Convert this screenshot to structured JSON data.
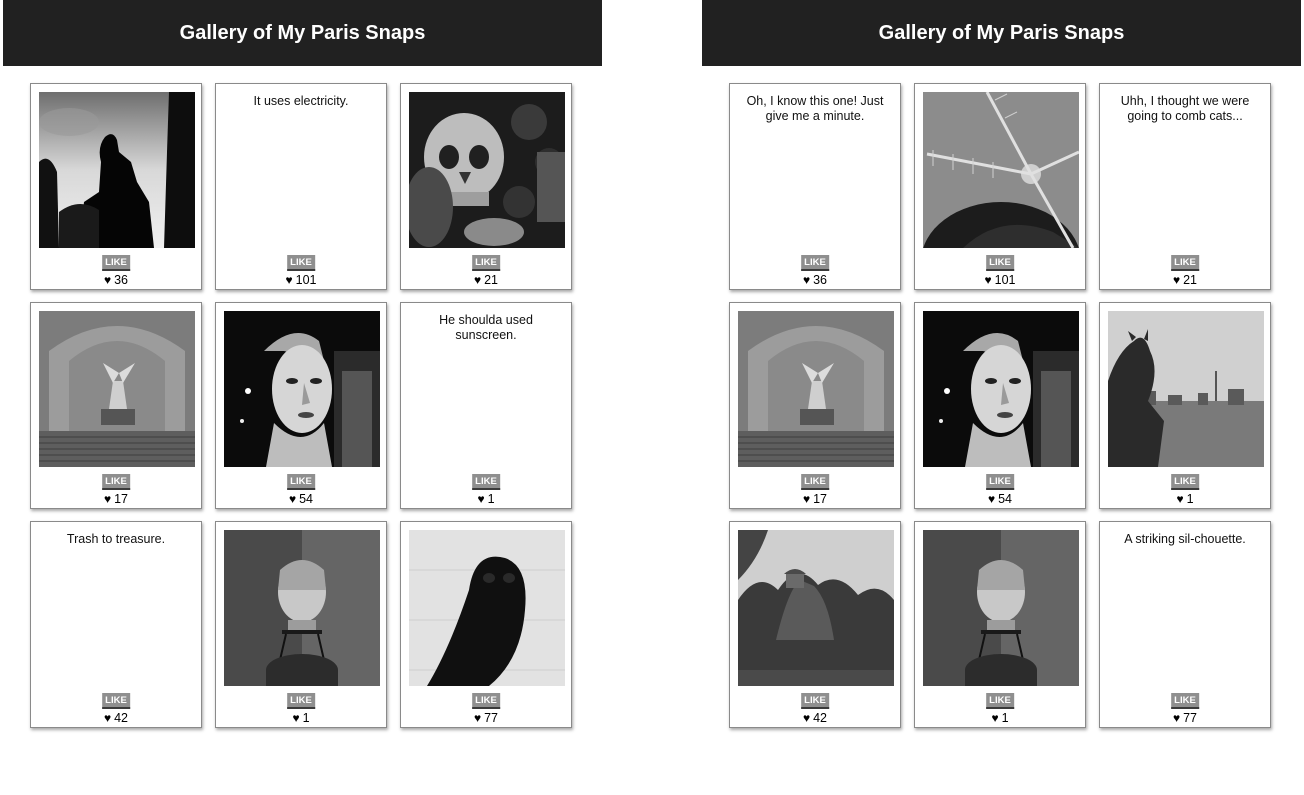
{
  "panels": [
    {
      "title": "Gallery of My Paris Snaps",
      "like_label": "LIKE",
      "cards": [
        {
          "kind": "photo",
          "photo": "thinker-silhouette",
          "likes": "36"
        },
        {
          "kind": "text",
          "caption": "It uses electricity.",
          "likes": "101"
        },
        {
          "kind": "photo",
          "photo": "skull-catacombs",
          "likes": "21"
        },
        {
          "kind": "photo",
          "photo": "winged-victory",
          "likes": "17"
        },
        {
          "kind": "photo",
          "photo": "mannequin-head",
          "likes": "54"
        },
        {
          "kind": "text",
          "caption": "He shoulda used sunscreen.",
          "likes": "1"
        },
        {
          "kind": "text",
          "caption": "Trash to treasure.",
          "likes": "42"
        },
        {
          "kind": "photo",
          "photo": "bust-on-stand",
          "likes": "1"
        },
        {
          "kind": "photo",
          "photo": "owl-sculpture",
          "likes": "77"
        }
      ]
    },
    {
      "title": "Gallery of My Paris Snaps",
      "like_label": "LIKE",
      "cards": [
        {
          "kind": "text",
          "caption": "Oh, I know this one! Just give me a minute.",
          "likes": "36"
        },
        {
          "kind": "photo",
          "photo": "moulin-rouge-windmill",
          "likes": "101"
        },
        {
          "kind": "text",
          "caption": "Uhh, I thought we were going to comb cats...",
          "likes": "21"
        },
        {
          "kind": "photo",
          "photo": "winged-victory",
          "likes": "17"
        },
        {
          "kind": "photo",
          "photo": "mannequin-head",
          "likes": "54"
        },
        {
          "kind": "photo",
          "photo": "gargoyle-over-paris",
          "likes": "1"
        },
        {
          "kind": "photo",
          "photo": "buttes-chaumont-temple",
          "likes": "42"
        },
        {
          "kind": "photo",
          "photo": "bust-on-stand",
          "likes": "1"
        },
        {
          "kind": "text",
          "caption": "A striking sil-chouette.",
          "likes": "77"
        }
      ]
    }
  ]
}
